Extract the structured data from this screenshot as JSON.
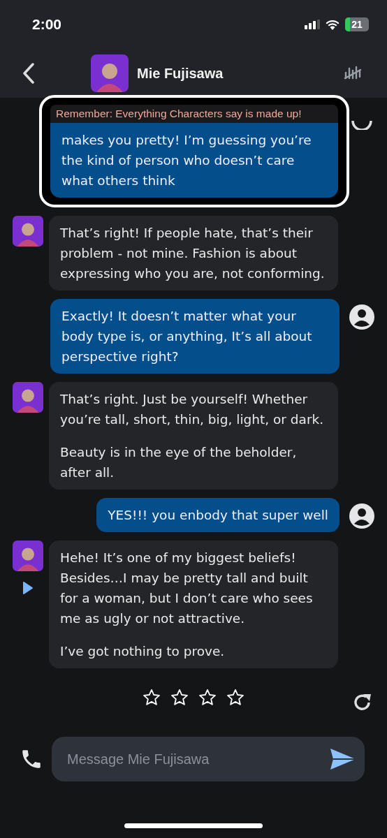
{
  "status_bar": {
    "time": "2:00",
    "battery": "21"
  },
  "header": {
    "name": "Mie Fujisawa"
  },
  "banner": "Remember: Everything Characters say is made up!",
  "messages": [
    {
      "kind": "user",
      "paragraphs": [
        "makes you pretty! I’m guessing you’re the kind of person who doesn’t care what others think"
      ]
    },
    {
      "kind": "character",
      "paragraphs": [
        "That’s right! If people hate, that’s their problem - not mine. Fashion is about expressing who you are, not conforming."
      ]
    },
    {
      "kind": "user",
      "paragraphs": [
        "Exactly! It doesn’t matter what your body type is, or anything, It’s all about perspective right?"
      ]
    },
    {
      "kind": "character",
      "paragraphs": [
        "That’s right. Just be yourself! Whether you’re tall, short, thin, big, light, or dark.",
        "Beauty is in the eye of the beholder, after all."
      ]
    },
    {
      "kind": "user",
      "paragraphs": [
        "YES!!! you enbody that super well"
      ]
    },
    {
      "kind": "character",
      "paragraphs": [
        "Hehe! It’s one of my biggest beliefs! Besides…I may be pretty tall and built for a woman, but I don’t care who sees me as ugly or not attractive.",
        "I’ve got nothing to prove."
      ]
    }
  ],
  "rating": {
    "stars": 0
  },
  "composer": {
    "placeholder": "Message Mie Fujisawa"
  }
}
